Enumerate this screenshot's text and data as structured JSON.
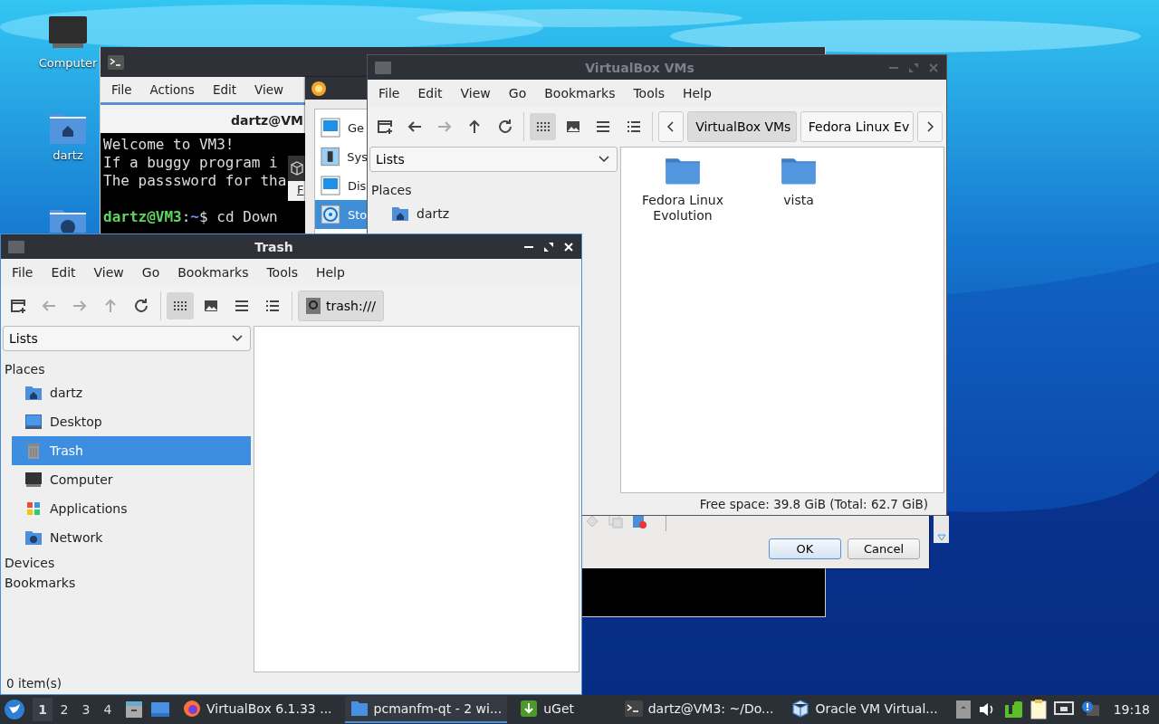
{
  "desktop": {
    "icons": [
      {
        "label": "Computer",
        "kind": "computer"
      },
      {
        "label": "dartz",
        "kind": "home"
      },
      {
        "kind": "network"
      }
    ]
  },
  "terminal": {
    "menu": [
      "File",
      "Actions",
      "Edit",
      "View"
    ],
    "tab_title": "dartz@VM",
    "lines": [
      {
        "kind": "plain",
        "text": "Welcome to VM3!"
      },
      {
        "kind": "plain",
        "text": "If a buggy program i"
      },
      {
        "kind": "plain",
        "text": "The passsword for tha"
      },
      {
        "kind": "blank"
      },
      {
        "kind": "prompt",
        "user": "dartz@VM3",
        "separator": ":",
        "path": "~",
        "command": "$ cd Down"
      }
    ]
  },
  "vbox_manager": {
    "menu": [
      "F"
    ]
  },
  "settings_dialog": {
    "sections": [
      {
        "label": "Ge",
        "kind": "display",
        "selected": false
      },
      {
        "label": "Sys",
        "kind": "chip",
        "selected": false
      },
      {
        "label": "Dis",
        "kind": "display",
        "selected": false
      },
      {
        "label": "Sto",
        "kind": "disk",
        "selected": true
      }
    ],
    "buttons": [
      {
        "label": "OK",
        "default": true
      },
      {
        "label": "Cancel",
        "default": false
      }
    ]
  },
  "vms_window": {
    "title": "VirtualBox VMs",
    "active": false,
    "menu": [
      "File",
      "Edit",
      "View",
      "Go",
      "Bookmarks",
      "Tools",
      "Help"
    ],
    "toolbar": [
      {
        "kind": "new-tab",
        "disabled": false,
        "selected": false
      },
      {
        "kind": "back",
        "disabled": false,
        "selected": false
      },
      {
        "kind": "forward",
        "disabled": true,
        "selected": false
      },
      {
        "kind": "up",
        "disabled": false,
        "selected": false
      },
      {
        "kind": "reload",
        "disabled": false,
        "selected": false
      },
      {
        "kind": "icon-view",
        "disabled": false,
        "selected": true
      },
      {
        "kind": "thumbnail-view",
        "disabled": false,
        "selected": false
      },
      {
        "kind": "compact-view",
        "disabled": false,
        "selected": false
      },
      {
        "kind": "detailed-view",
        "disabled": false,
        "selected": false
      }
    ],
    "path": [
      {
        "label": "VirtualBox VMs",
        "selected": true
      },
      {
        "label": "Fedora Linux Ev",
        "selected": false
      }
    ],
    "side_pane": "Lists",
    "places_heading": "Places",
    "places": [
      {
        "label": "dartz",
        "kind": "home",
        "selected": false
      }
    ],
    "files": [
      {
        "name": "Fedora Linux Evolution"
      },
      {
        "name": "vista"
      }
    ],
    "status": "Free space: 39.8 GiB (Total: 62.7 GiB)"
  },
  "trash_window": {
    "title": "Trash",
    "active": true,
    "menu": [
      "File",
      "Edit",
      "View",
      "Go",
      "Bookmarks",
      "Tools",
      "Help"
    ],
    "toolbar": [
      {
        "kind": "new-tab",
        "disabled": false,
        "selected": false
      },
      {
        "kind": "back",
        "disabled": true,
        "selected": false
      },
      {
        "kind": "forward",
        "disabled": true,
        "selected": false
      },
      {
        "kind": "up",
        "disabled": true,
        "selected": false
      },
      {
        "kind": "reload",
        "disabled": false,
        "selected": false
      },
      {
        "kind": "icon-view",
        "disabled": false,
        "selected": true
      },
      {
        "kind": "thumbnail-view",
        "disabled": false,
        "selected": false
      },
      {
        "kind": "compact-view",
        "disabled": false,
        "selected": false
      },
      {
        "kind": "detailed-view",
        "disabled": false,
        "selected": false
      }
    ],
    "path": [
      {
        "label": "trash:///",
        "selected": true
      }
    ],
    "side_pane": "Lists",
    "places_heading": "Places",
    "places": [
      {
        "label": "dartz",
        "kind": "home",
        "selected": false
      },
      {
        "label": "Desktop",
        "kind": "desktop",
        "selected": false
      },
      {
        "label": "Trash",
        "kind": "trash",
        "selected": true
      },
      {
        "label": "Computer",
        "kind": "computer",
        "selected": false
      },
      {
        "label": "Applications",
        "kind": "apps",
        "selected": false
      },
      {
        "label": "Network",
        "kind": "network",
        "selected": false
      }
    ],
    "other_headings": [
      "Devices",
      "Bookmarks"
    ],
    "status": "0 item(s)"
  },
  "taskbar": {
    "workspaces": [
      {
        "label": "1",
        "selected": true
      },
      {
        "label": "2",
        "selected": false
      },
      {
        "label": "3",
        "selected": false
      },
      {
        "label": "4",
        "selected": false
      }
    ],
    "tasks": [
      {
        "label": "VirtualBox 6.1.33 ...",
        "kind": "firefox",
        "selected": false
      },
      {
        "label": "pcmanfm-qt - 2 wi...",
        "kind": "folder",
        "selected": true
      },
      {
        "label": "uGet",
        "kind": "uget",
        "selected": false
      },
      {
        "label": "dartz@VM3: ~/Do...",
        "kind": "terminal",
        "selected": false
      },
      {
        "label": "Oracle VM Virtual...",
        "kind": "virtualbox",
        "selected": false
      }
    ],
    "clock": "19:18"
  }
}
